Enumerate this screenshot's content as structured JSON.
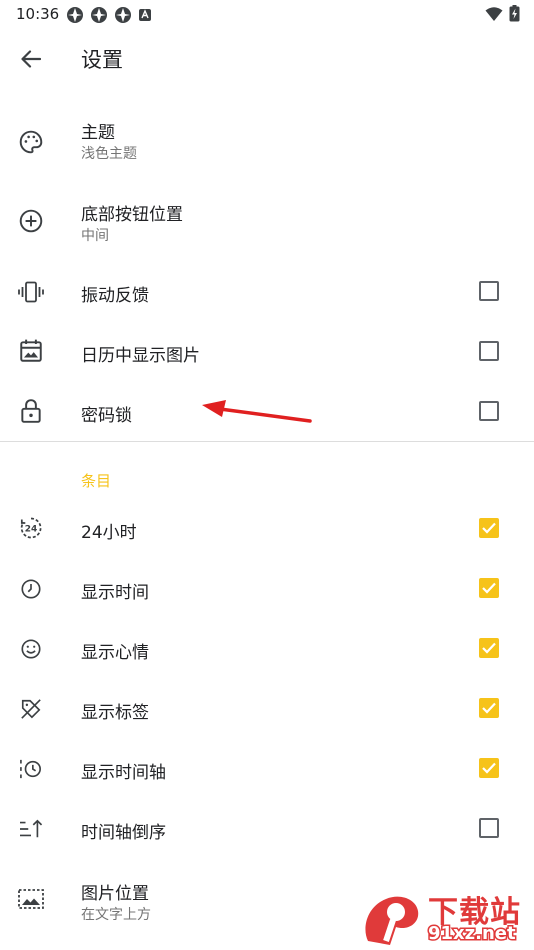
{
  "status_bar": {
    "time": "10:36"
  },
  "app_bar": {
    "title": "设置"
  },
  "settings": [
    {
      "title": "主题",
      "subtitle": "浅色主题"
    },
    {
      "title": "底部按钮位置",
      "subtitle": "中间"
    },
    {
      "title": "振动反馈",
      "checked": false
    },
    {
      "title": "日历中显示图片",
      "checked": false
    },
    {
      "title": "密码锁",
      "checked": false
    }
  ],
  "section": {
    "title": "条目"
  },
  "entries": [
    {
      "title": "24小时",
      "checked": true
    },
    {
      "title": "显示时间",
      "checked": true
    },
    {
      "title": "显示心情",
      "checked": true
    },
    {
      "title": "显示标签",
      "checked": true
    },
    {
      "title": "显示时间轴",
      "checked": true
    },
    {
      "title": "时间轴倒序",
      "checked": false
    },
    {
      "title": "图片位置",
      "subtitle": "在文字上方"
    }
  ],
  "watermark": {
    "top": "下载站",
    "bottom": "91xz.net"
  },
  "colors": {
    "accent": "#F6C31A",
    "annotation_arrow": "#e02020"
  },
  "icons": {
    "theme": "palette-icon",
    "bottom_button": "add-circle-icon",
    "vibration": "vibration-icon",
    "calendar": "calendar-image-icon",
    "lock": "lock-icon",
    "hours": "24-hours-icon",
    "time": "clock-icon",
    "mood": "smiley-icon",
    "tag": "tag-off-icon",
    "timeline": "timeline-clock-icon",
    "reverse": "sort-ascending-icon",
    "image_position": "image-position-icon"
  }
}
